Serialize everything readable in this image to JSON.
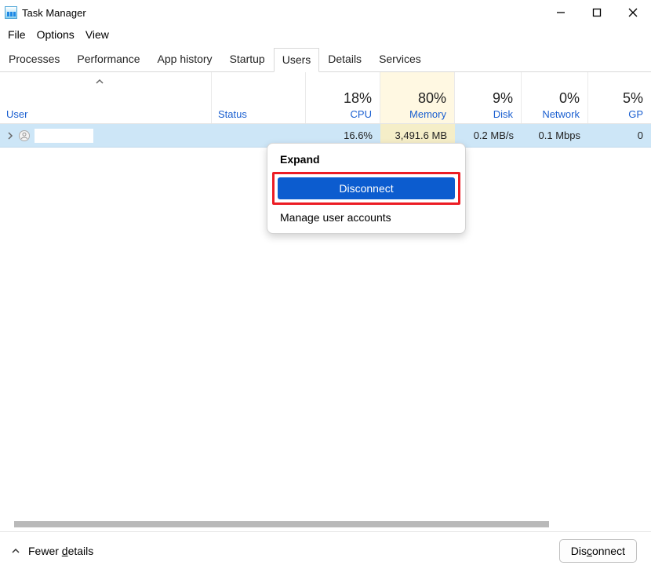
{
  "window": {
    "title": "Task Manager"
  },
  "menu": {
    "file": "File",
    "options": "Options",
    "view": "View"
  },
  "tabs": {
    "processes": "Processes",
    "performance": "Performance",
    "app_history": "App history",
    "startup": "Startup",
    "users": "Users",
    "details": "Details",
    "services": "Services"
  },
  "columns": {
    "user_label": "User",
    "status_label": "Status",
    "cpu_pct": "18%",
    "cpu_label": "CPU",
    "mem_pct": "80%",
    "mem_label": "Memory",
    "disk_pct": "9%",
    "disk_label": "Disk",
    "net_pct": "0%",
    "net_label": "Network",
    "gpu_pct": "5%",
    "gpu_label": "GP"
  },
  "row": {
    "cpu": "16.6%",
    "mem": "3,491.6 MB",
    "disk": "0.2 MB/s",
    "net": "0.1 Mbps",
    "gpu": "0"
  },
  "context_menu": {
    "expand": "Expand",
    "disconnect": "Disconnect",
    "manage": "Manage user accounts"
  },
  "footer": {
    "fewer_pre": "Fewer ",
    "fewer_letter": "d",
    "fewer_post": "etails",
    "disconnect_pre": "Dis",
    "disconnect_letter": "c",
    "disconnect_post": "onnect"
  }
}
